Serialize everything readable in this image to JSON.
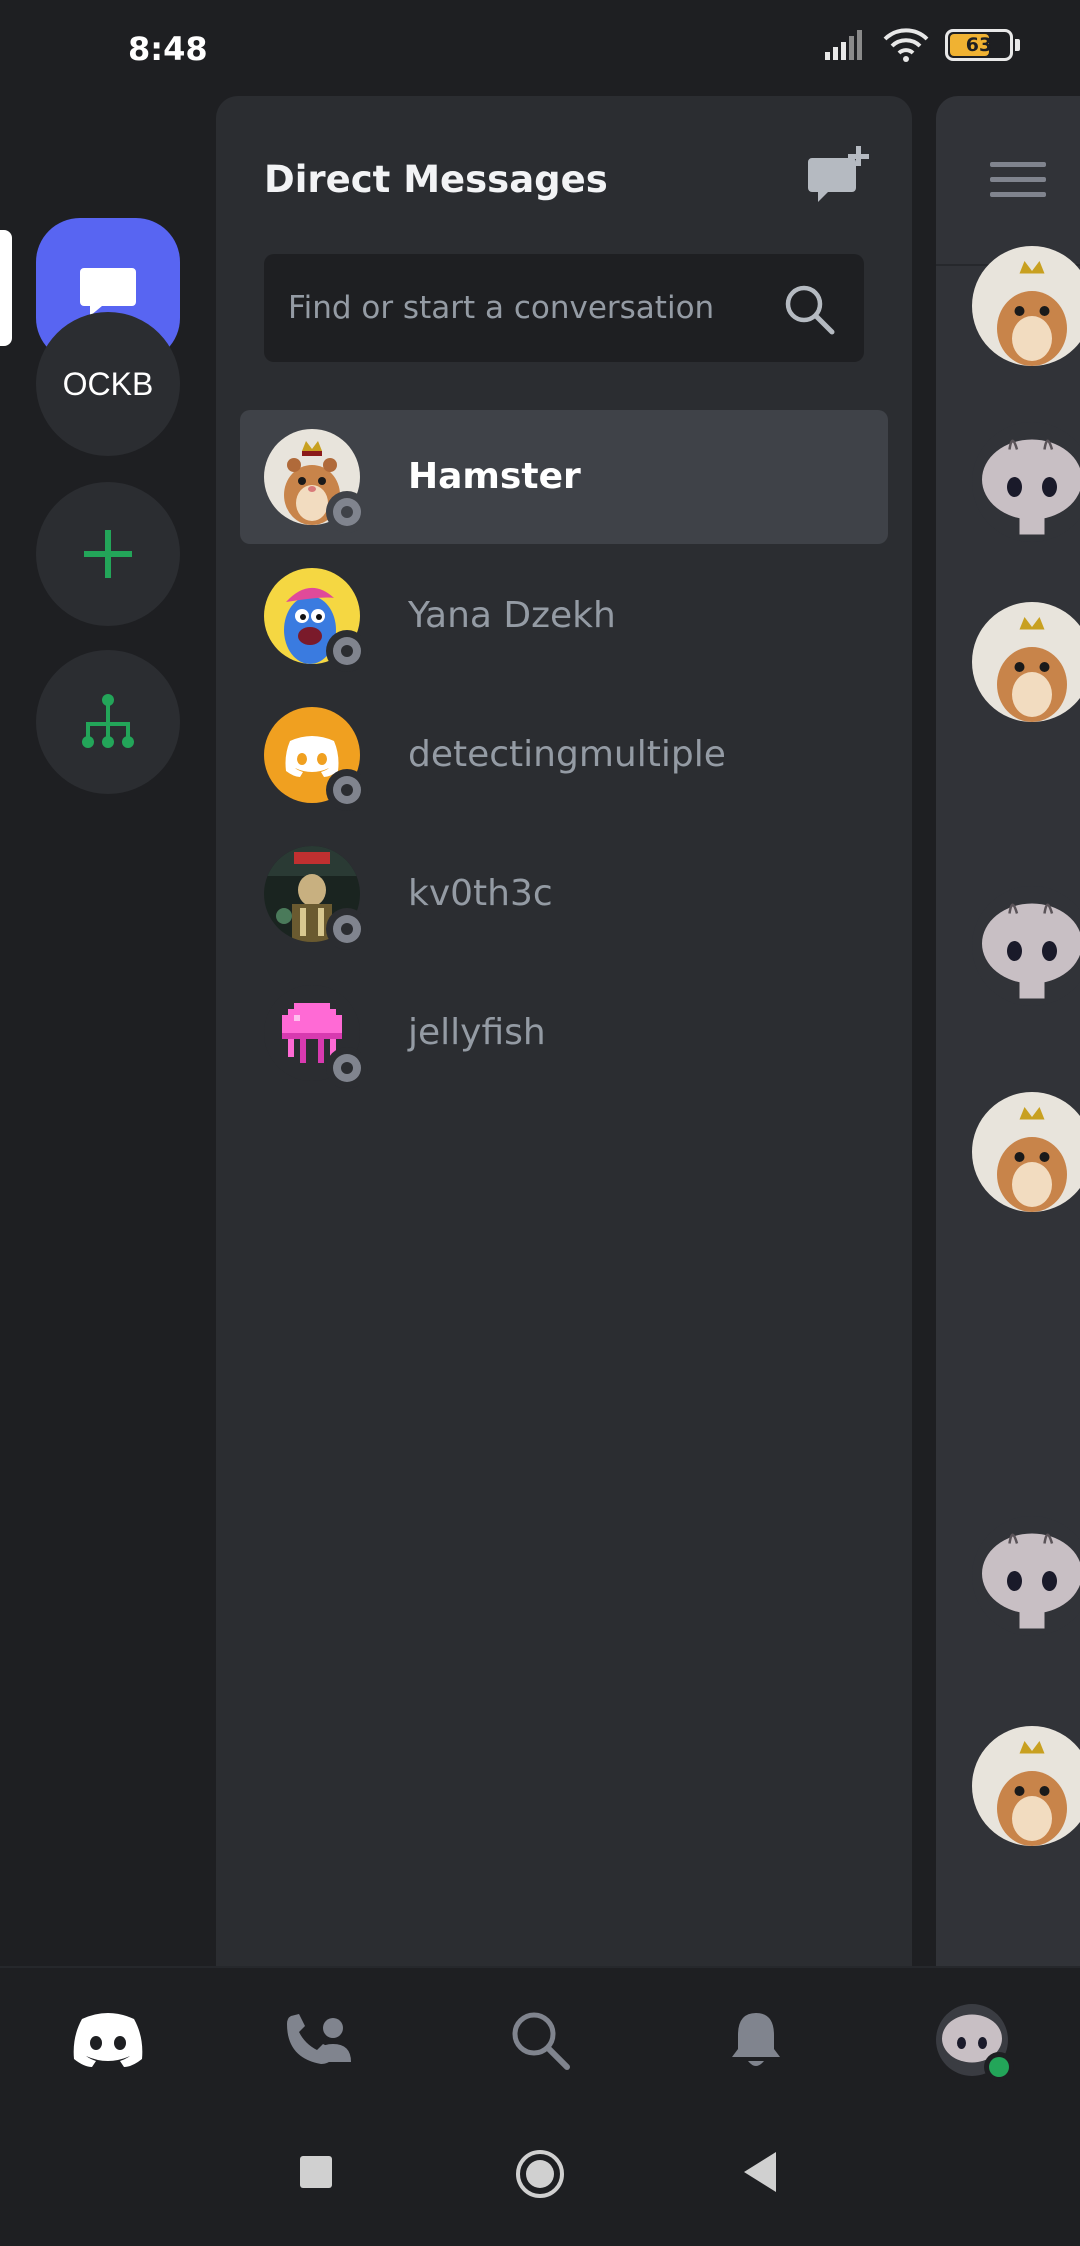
{
  "status_bar": {
    "time": "8:48",
    "battery": "63"
  },
  "rail": {
    "servers": [
      {
        "label": "OCKB"
      }
    ]
  },
  "dm_panel": {
    "title": "Direct Messages",
    "search_placeholder": "Find or start a conversation",
    "conversations": [
      {
        "name": "Hamster",
        "selected": true,
        "status": "offline"
      },
      {
        "name": "Yana Dzekh",
        "selected": false,
        "status": "offline"
      },
      {
        "name": "detectingmultiple",
        "selected": false,
        "status": "offline"
      },
      {
        "name": "kv0th3c",
        "selected": false,
        "status": "offline"
      },
      {
        "name": "jellyfish",
        "selected": false,
        "status": "offline"
      }
    ]
  },
  "colors": {
    "brand": "#5865f2",
    "add_server_green": "#23a559",
    "online": "#23a559",
    "offline": "#80848e",
    "default_avatar_orange": "#f0a020"
  },
  "bottom_nav": {
    "items": [
      "discord-logo-icon",
      "friends-icon",
      "search-icon",
      "notifications-bell-icon",
      "profile-avatar"
    ]
  }
}
